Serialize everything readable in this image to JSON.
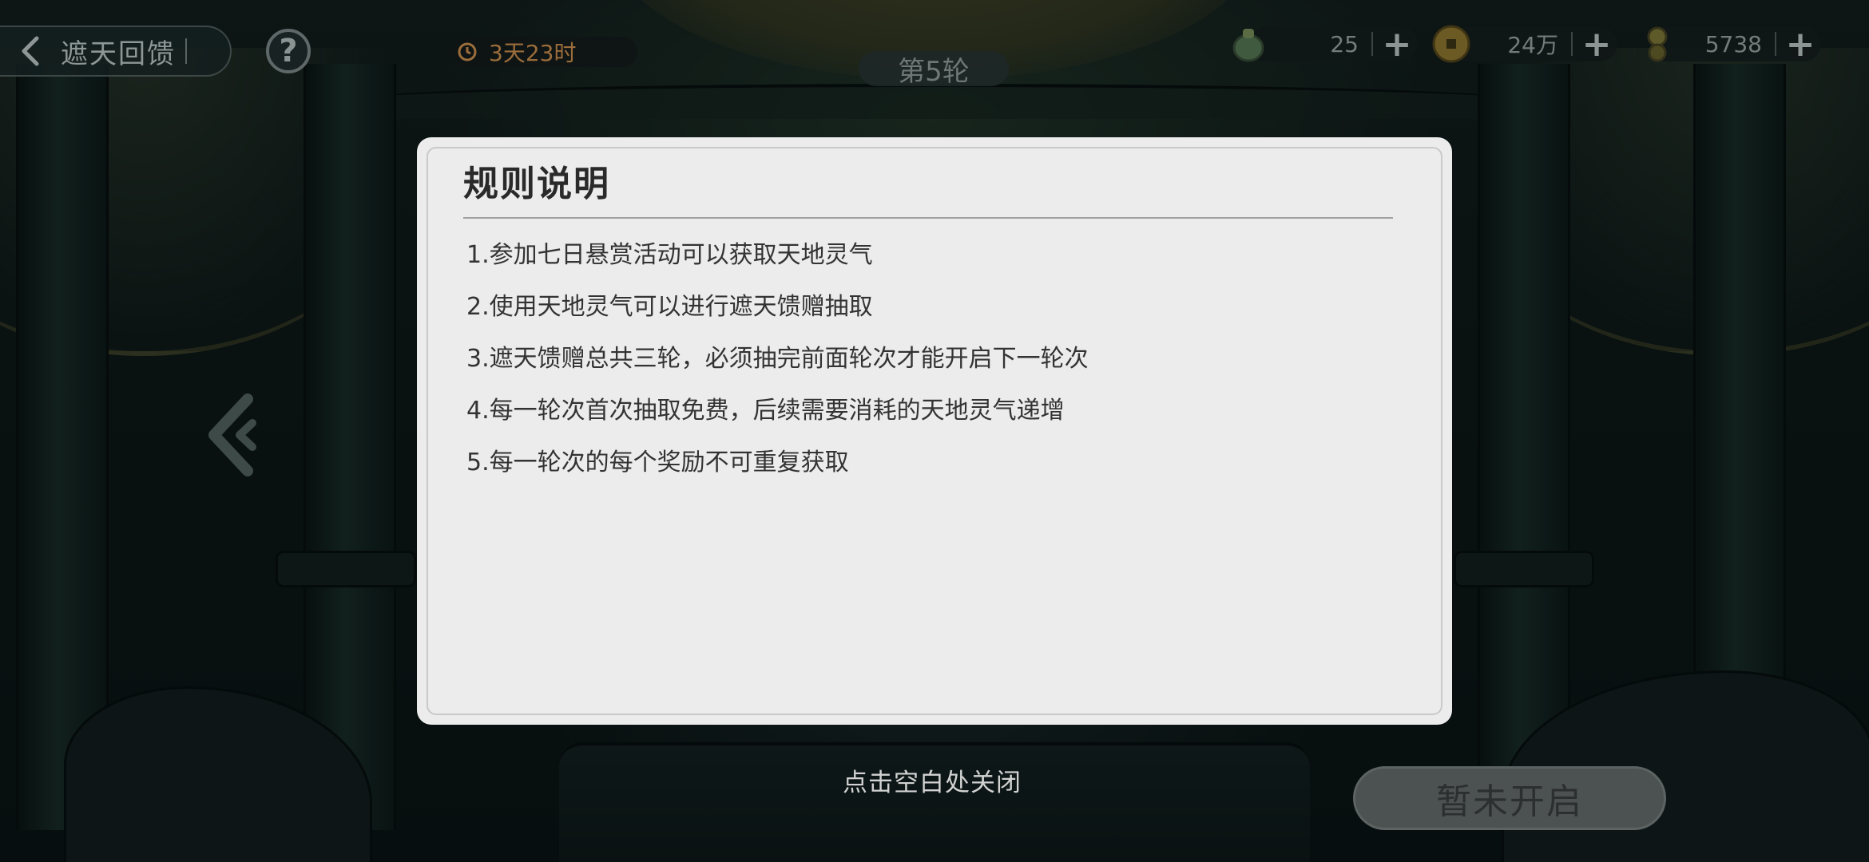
{
  "header": {
    "back_title": "遮天回馈",
    "help_symbol": "?",
    "timer_text": "3天23时",
    "round_label": "第5轮"
  },
  "resources": [
    {
      "icon": "jade-bell-icon",
      "value": "25",
      "plus": "+"
    },
    {
      "icon": "gold-coin-icon",
      "value": "24万",
      "plus": "+"
    },
    {
      "icon": "gourd-icon",
      "value": "5738",
      "plus": "+"
    }
  ],
  "modal": {
    "title": "规则说明",
    "rules": [
      "1.参加七日悬赏活动可以获取天地灵气",
      "2.使用天地灵气可以进行遮天馈赠抽取",
      "3.遮天馈赠总共三轮，必须抽完前面轮次才能开启下一轮次",
      "4.每一轮次首次抽取免费，后续需要消耗的天地灵气递增",
      "5.每一轮次的每个奖励不可重复获取"
    ]
  },
  "footer": {
    "close_hint": "点击空白处关闭",
    "locked_button_label": "暂未开启"
  },
  "colors": {
    "modal_bg": "#ececec",
    "timer_text": "#9b6d3a",
    "dim_overlay": "rgba(0,0,0,0.5)"
  }
}
